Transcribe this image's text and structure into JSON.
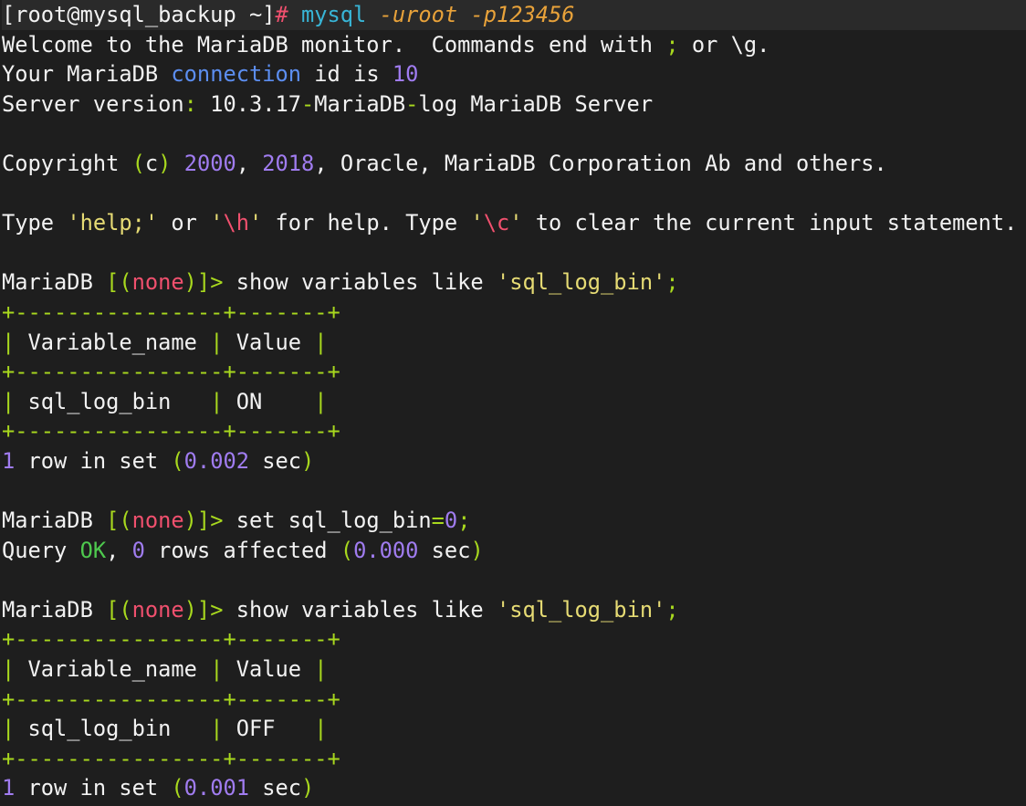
{
  "colors": {
    "background": "#1e1e1e",
    "text": "#f2f2f2",
    "command": "#38b5d6",
    "argument": "#e8a23a",
    "operator": "#f0506e",
    "punctuation": "#a8d81e",
    "number": "#a07cf0",
    "keyword": "#5c8ef0",
    "string": "#e6db74",
    "ok": "#4ec94e"
  },
  "lines": [
    {
      "cls": "first",
      "tokens": [
        {
          "t": "[root@mysql_backup ~]",
          "c": "txt"
        },
        {
          "t": "#",
          "c": "op"
        },
        {
          "t": " ",
          "c": "txt"
        },
        {
          "t": "mysql",
          "c": "cmd"
        },
        {
          "t": " ",
          "c": "txt"
        },
        {
          "t": "-uroot",
          "c": "arg"
        },
        {
          "t": " ",
          "c": "txt"
        },
        {
          "t": "-p123456",
          "c": "arg"
        }
      ]
    },
    {
      "tokens": [
        {
          "t": "Welcome to the MariaDB monitor.  Commands end with ",
          "c": "txt"
        },
        {
          "t": ";",
          "c": "punc"
        },
        {
          "t": " or \\g.",
          "c": "txt"
        }
      ]
    },
    {
      "tokens": [
        {
          "t": "Your MariaDB ",
          "c": "txt"
        },
        {
          "t": "connection",
          "c": "kw"
        },
        {
          "t": " id is ",
          "c": "txt"
        },
        {
          "t": "10",
          "c": "num"
        }
      ]
    },
    {
      "tokens": [
        {
          "t": "Server version",
          "c": "txt"
        },
        {
          "t": ":",
          "c": "punc"
        },
        {
          "t": " 10.3.17",
          "c": "txt"
        },
        {
          "t": "-",
          "c": "punc"
        },
        {
          "t": "MariaDB",
          "c": "txt"
        },
        {
          "t": "-",
          "c": "punc"
        },
        {
          "t": "log MariaDB Server",
          "c": "txt"
        }
      ]
    },
    {
      "tokens": []
    },
    {
      "tokens": [
        {
          "t": "Copyright ",
          "c": "txt"
        },
        {
          "t": "(",
          "c": "punc"
        },
        {
          "t": "c",
          "c": "txt"
        },
        {
          "t": ")",
          "c": "punc"
        },
        {
          "t": " ",
          "c": "txt"
        },
        {
          "t": "2000",
          "c": "num"
        },
        {
          "t": ", ",
          "c": "txt"
        },
        {
          "t": "2018",
          "c": "num"
        },
        {
          "t": ", Oracle, MariaDB Corporation Ab and others.",
          "c": "txt"
        }
      ]
    },
    {
      "tokens": []
    },
    {
      "tokens": [
        {
          "t": "Type ",
          "c": "txt"
        },
        {
          "t": "'help;'",
          "c": "str"
        },
        {
          "t": " or ",
          "c": "txt"
        },
        {
          "t": "'",
          "c": "str"
        },
        {
          "t": "\\h",
          "c": "op"
        },
        {
          "t": "'",
          "c": "str"
        },
        {
          "t": " for help. Type ",
          "c": "txt"
        },
        {
          "t": "'",
          "c": "str"
        },
        {
          "t": "\\c",
          "c": "op"
        },
        {
          "t": "'",
          "c": "str"
        },
        {
          "t": " to clear the current input statement.",
          "c": "txt"
        }
      ]
    },
    {
      "tokens": []
    },
    {
      "tokens": [
        {
          "t": "MariaDB ",
          "c": "txt"
        },
        {
          "t": "[(",
          "c": "punc"
        },
        {
          "t": "none",
          "c": "none"
        },
        {
          "t": ")]>",
          "c": "punc"
        },
        {
          "t": " show variables like ",
          "c": "txt"
        },
        {
          "t": "'sql_log_bin'",
          "c": "str"
        },
        {
          "t": ";",
          "c": "punc"
        }
      ]
    },
    {
      "tokens": [
        {
          "t": "+----------------+-------+",
          "c": "border"
        }
      ]
    },
    {
      "tokens": [
        {
          "t": "|",
          "c": "border"
        },
        {
          "t": " Variable_name ",
          "c": "txt"
        },
        {
          "t": "|",
          "c": "border"
        },
        {
          "t": " Value ",
          "c": "txt"
        },
        {
          "t": "|",
          "c": "border"
        }
      ]
    },
    {
      "tokens": [
        {
          "t": "+----------------+-------+",
          "c": "border"
        }
      ]
    },
    {
      "tokens": [
        {
          "t": "|",
          "c": "border"
        },
        {
          "t": " sql_log_bin   ",
          "c": "txt"
        },
        {
          "t": "|",
          "c": "border"
        },
        {
          "t": " ON    ",
          "c": "txt"
        },
        {
          "t": "|",
          "c": "border"
        }
      ]
    },
    {
      "tokens": [
        {
          "t": "+----------------+-------+",
          "c": "border"
        }
      ]
    },
    {
      "tokens": [
        {
          "t": "1",
          "c": "num"
        },
        {
          "t": " row in set ",
          "c": "txt"
        },
        {
          "t": "(",
          "c": "punc"
        },
        {
          "t": "0.002",
          "c": "num"
        },
        {
          "t": " sec",
          "c": "txt"
        },
        {
          "t": ")",
          "c": "punc"
        }
      ]
    },
    {
      "tokens": []
    },
    {
      "tokens": [
        {
          "t": "MariaDB ",
          "c": "txt"
        },
        {
          "t": "[(",
          "c": "punc"
        },
        {
          "t": "none",
          "c": "none"
        },
        {
          "t": ")]>",
          "c": "punc"
        },
        {
          "t": " set sql_log_bin",
          "c": "txt"
        },
        {
          "t": "=",
          "c": "punc"
        },
        {
          "t": "0",
          "c": "num"
        },
        {
          "t": ";",
          "c": "punc"
        }
      ]
    },
    {
      "tokens": [
        {
          "t": "Query ",
          "c": "txt"
        },
        {
          "t": "OK",
          "c": "ok"
        },
        {
          "t": ", ",
          "c": "txt"
        },
        {
          "t": "0",
          "c": "num"
        },
        {
          "t": " rows affected ",
          "c": "txt"
        },
        {
          "t": "(",
          "c": "punc"
        },
        {
          "t": "0.000",
          "c": "num"
        },
        {
          "t": " sec",
          "c": "txt"
        },
        {
          "t": ")",
          "c": "punc"
        }
      ]
    },
    {
      "tokens": []
    },
    {
      "tokens": [
        {
          "t": "MariaDB ",
          "c": "txt"
        },
        {
          "t": "[(",
          "c": "punc"
        },
        {
          "t": "none",
          "c": "none"
        },
        {
          "t": ")]>",
          "c": "punc"
        },
        {
          "t": " show variables like ",
          "c": "txt"
        },
        {
          "t": "'sql_log_bin'",
          "c": "str"
        },
        {
          "t": ";",
          "c": "punc"
        }
      ]
    },
    {
      "tokens": [
        {
          "t": "+----------------+-------+",
          "c": "border"
        }
      ]
    },
    {
      "tokens": [
        {
          "t": "|",
          "c": "border"
        },
        {
          "t": " Variable_name ",
          "c": "txt"
        },
        {
          "t": "|",
          "c": "border"
        },
        {
          "t": " Value ",
          "c": "txt"
        },
        {
          "t": "|",
          "c": "border"
        }
      ]
    },
    {
      "tokens": [
        {
          "t": "+----------------+-------+",
          "c": "border"
        }
      ]
    },
    {
      "tokens": [
        {
          "t": "|",
          "c": "border"
        },
        {
          "t": " sql_log_bin   ",
          "c": "txt"
        },
        {
          "t": "|",
          "c": "border"
        },
        {
          "t": " OFF   ",
          "c": "txt"
        },
        {
          "t": "|",
          "c": "border"
        }
      ]
    },
    {
      "tokens": [
        {
          "t": "+----------------+-------+",
          "c": "border"
        }
      ]
    },
    {
      "tokens": [
        {
          "t": "1",
          "c": "num"
        },
        {
          "t": " row in set ",
          "c": "txt"
        },
        {
          "t": "(",
          "c": "punc"
        },
        {
          "t": "0.001",
          "c": "num"
        },
        {
          "t": " sec",
          "c": "txt"
        },
        {
          "t": ")",
          "c": "punc"
        }
      ]
    }
  ]
}
